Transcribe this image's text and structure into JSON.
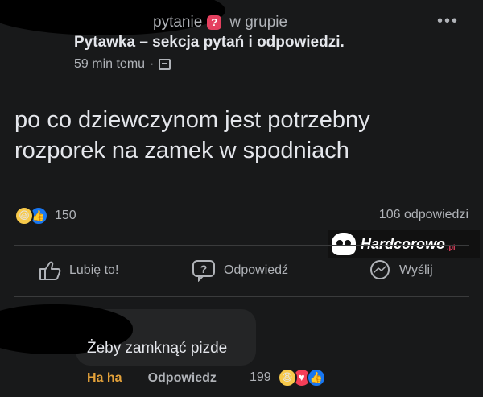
{
  "post": {
    "header_type": "pytanie",
    "header_in_group": "w grupie",
    "group_name": "Pytawka – sekcja pytań i odpowiedzi.",
    "time": "59 min temu",
    "meta_separator": "·",
    "more_icon": "more-dots-icon",
    "text": "po co dziewczynom jest potrzebny rozporek na zamek w spodniach",
    "reaction_count": "150",
    "comments_count": "106 odpowiedzi"
  },
  "actions": {
    "like_label": "Lubię to!",
    "answer_label": "Odpowiedź",
    "send_label": "Wyślij"
  },
  "watermark": {
    "text": "Hardcorowo",
    "suffix": ".pl"
  },
  "comment": {
    "text": "Żeby zamknąć pizde",
    "haha_label": "Ha ha",
    "reply_label": "Odpowiedz",
    "reaction_count": "199"
  },
  "colors": {
    "background": "#18191a",
    "haha_accent": "#e4a23a",
    "like_blue": "#1877f2",
    "love_red": "#f33e58"
  }
}
